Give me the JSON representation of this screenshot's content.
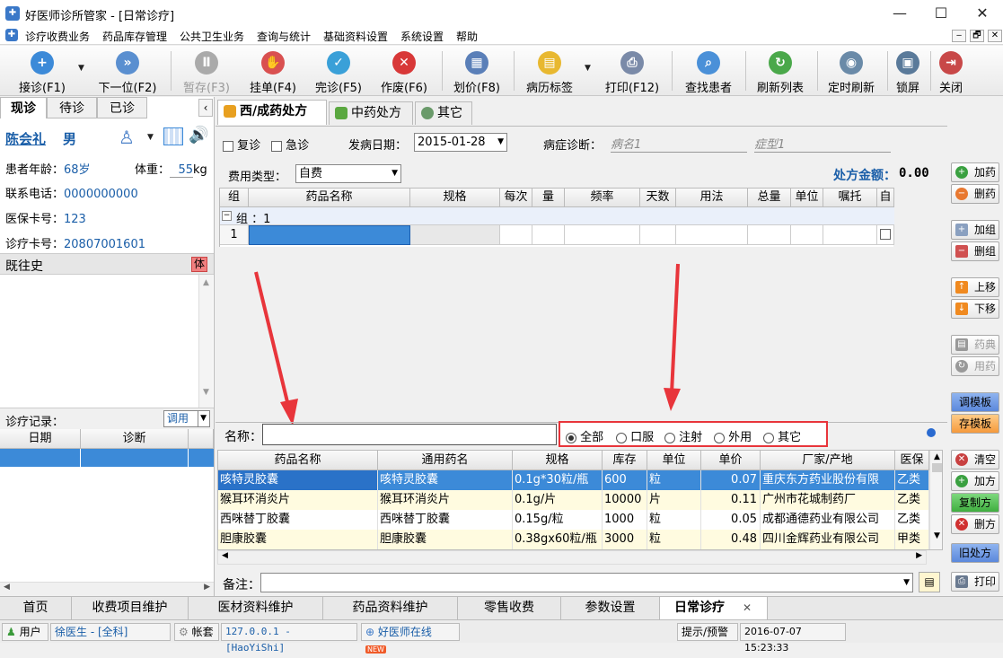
{
  "window": {
    "title": "好医师诊所管家 - [日常诊疗]",
    "min": "—",
    "max": "☐",
    "close": "✕"
  },
  "menu": [
    "诊疗收费业务",
    "药品库存管理",
    "公共卫生业务",
    "查询与统计",
    "基础资料设置",
    "系统设置",
    "帮助"
  ],
  "mdi": [
    "‒",
    "🗗",
    "✕"
  ],
  "toolbar": [
    {
      "label": "接诊(F1)",
      "icon": "doc-add-icon",
      "color": "#3c8ad8",
      "g": "+"
    },
    {
      "label": "下一位(F2)",
      "icon": "person-next-icon",
      "color": "#5a8fd0",
      "g": "»"
    },
    {
      "label": "暂存(F3)",
      "icon": "pause-icon",
      "color": "#aaaaaa",
      "g": "Ⅱ"
    },
    {
      "label": "挂单(F4)",
      "icon": "hand-stop-icon",
      "color": "#d95050",
      "g": "✋"
    },
    {
      "label": "完诊(F5)",
      "icon": "check-icon",
      "color": "#3aa0d8",
      "g": "✓"
    },
    {
      "label": "作废(F6)",
      "icon": "cancel-icon",
      "color": "#d83838",
      "g": "✕"
    },
    {
      "label": "划价(F8)",
      "icon": "calculator-icon",
      "color": "#5a7fb8",
      "g": "▦"
    },
    {
      "label": "病历标签",
      "icon": "folder-icon",
      "color": "#e8b830",
      "g": "▤"
    },
    {
      "label": "打印(F12)",
      "icon": "printer-icon",
      "color": "#7a8aa8",
      "g": "⎙"
    },
    {
      "label": "查找患者",
      "icon": "magnifier-icon",
      "color": "#4a90d8",
      "g": "⌕"
    },
    {
      "label": "刷新列表",
      "icon": "refresh-icon",
      "color": "#4aa84a",
      "g": "↻"
    },
    {
      "label": "定时刷新",
      "icon": "eye-icon",
      "color": "#6a8aa8",
      "g": "◉"
    },
    {
      "label": "锁屏",
      "icon": "monitor-lock-icon",
      "color": "#5a7a9a",
      "g": "▣"
    },
    {
      "label": "关闭",
      "icon": "exit-icon",
      "color": "#c84848",
      "g": "⇥"
    }
  ],
  "left": {
    "tabs": [
      "现诊",
      "待诊",
      "已诊"
    ],
    "patient_name": "陈会礼",
    "gender": "男",
    "age_label": "患者年龄：",
    "age": "68岁",
    "weight_label": "体重：",
    "weight": "55",
    "weight_unit": "kg",
    "phone_label": "联系电话：",
    "phone": "0000000000",
    "insurance_label": "医保卡号：",
    "insurance": "123",
    "card_label": "诊疗卡号：",
    "card": "20807001601",
    "history_label": "既往史",
    "history_btn": "体",
    "records_label": "诊疗记录：",
    "records_combo": "调用",
    "records_cols": [
      "日期",
      "诊断"
    ]
  },
  "center": {
    "tabs": [
      "西/成药处方",
      "中药处方",
      "其它"
    ],
    "revisit": "复诊",
    "emergency": "急诊",
    "onset_label": "发病日期：",
    "onset_date": "2015-01-28",
    "diagnosis_label": "病症诊断：",
    "diagnosis_ph1": "病名1",
    "diagnosis_ph2": "症型1",
    "fee_label": "费用类型：",
    "fee_type": "自费",
    "amount_label": "处方金额：",
    "amount": "0.00",
    "rx_cols": [
      "组",
      "药品名称",
      "规格",
      "每次",
      "量",
      "频率",
      "天数",
      "用法",
      "总量",
      "单位",
      "嘱托",
      "自"
    ],
    "group_row": "组 ：1",
    "row_no": "1",
    "search_label": "名称：",
    "filters": [
      "全部",
      "口服",
      "注射",
      "外用",
      "其它"
    ],
    "drug_cols": [
      "药品名称",
      "通用药名",
      "规格",
      "库存",
      "单位",
      "单价",
      "厂家/产地",
      "医保"
    ],
    "drugs": [
      [
        "咳特灵胶囊",
        "咳特灵胶囊",
        "0.1g*30粒/瓶",
        "600",
        "粒",
        "0.07",
        "重庆东方药业股份有限",
        "乙类"
      ],
      [
        "猴耳环消炎片",
        "猴耳环消炎片",
        "0.1g/片",
        "10000",
        "片",
        "0.11",
        "广州市花城制药厂",
        "乙类"
      ],
      [
        "西咪替丁胶囊",
        "西咪替丁胶囊",
        "0.15g/粒",
        "1000",
        "粒",
        "0.05",
        "成都通德药业有限公司",
        "乙类"
      ],
      [
        "胆康胶囊",
        "胆康胶囊",
        "0.38gx60粒/瓶",
        "3000",
        "粒",
        "0.48",
        "四川金辉药业有限公司",
        "甲类"
      ]
    ],
    "remark_label": "备注："
  },
  "right_buttons": [
    "加药",
    "删药",
    "加组",
    "删组",
    "上移",
    "下移",
    "药典",
    "用药",
    "调模板",
    "存模板",
    "清空",
    "加方",
    "复制方",
    "删方",
    "旧处方",
    "打印"
  ],
  "bottom_tabs": [
    "首页",
    "收费项目维护",
    "医材资料维护",
    "药品资料维护",
    "零售收费",
    "参数设置",
    "日常诊疗"
  ],
  "bottom_close": "✕",
  "status": {
    "user_label": "用户",
    "user": "徐医生 - [全科]",
    "account": "帐套",
    "server": "127.0.0.1 - [HaoYiShi]",
    "online": "好医师在线",
    "new": "NEW",
    "alert": "提示/预警",
    "datetime": "2016-07-07 15:23:33"
  },
  "colors": {
    "accent": "#3c8ad8",
    "highlight_row": "#3c8ad8",
    "alt_row": "#fffbe0",
    "annotation": "#e8353b",
    "amount": "#1a5ea8"
  }
}
